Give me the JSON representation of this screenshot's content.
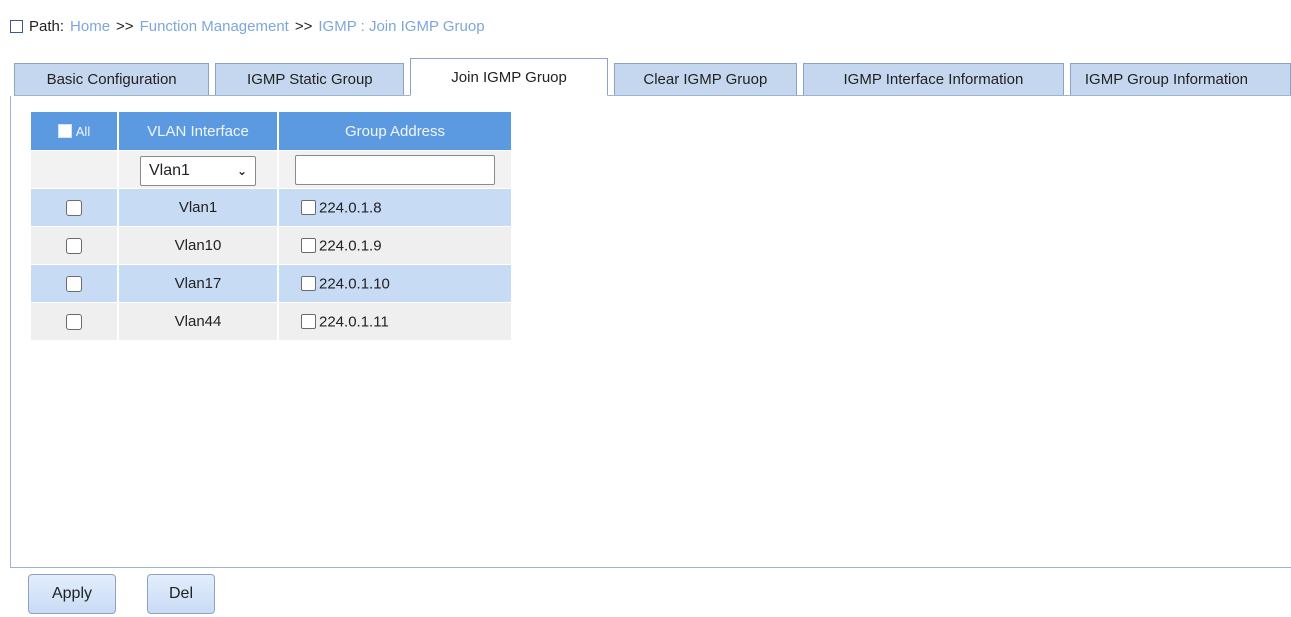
{
  "path": {
    "label": "Path:",
    "crumbs": [
      "Home",
      ">>",
      "Function Management",
      ">>",
      "IGMP : Join IGMP Gruop"
    ]
  },
  "tabs": [
    {
      "label": "Basic Configuration"
    },
    {
      "label": "IGMP Static Group"
    },
    {
      "label": "Join IGMP Gruop",
      "active": true
    },
    {
      "label": "Clear IGMP Gruop"
    },
    {
      "label": "IGMP Interface Information"
    },
    {
      "label": "IGMP Group Information"
    }
  ],
  "table": {
    "headers": {
      "all": "All",
      "vlan": "VLAN Interface",
      "group": "Group Address"
    },
    "filter": {
      "vlan_select": "Vlan1",
      "group_value": ""
    },
    "rows": [
      {
        "vlan": "Vlan1",
        "address": "224.0.1.8"
      },
      {
        "vlan": "Vlan10",
        "address": "224.0.1.9"
      },
      {
        "vlan": "Vlan17",
        "address": "224.0.1.10"
      },
      {
        "vlan": "Vlan44",
        "address": "224.0.1.11"
      }
    ]
  },
  "buttons": {
    "apply": "Apply",
    "del": "Del"
  },
  "colors": {
    "header": "#5b9ae0",
    "tab": "#c5d7ee",
    "row_alt": "#c8dbf5",
    "link": "#7ea7d8"
  }
}
